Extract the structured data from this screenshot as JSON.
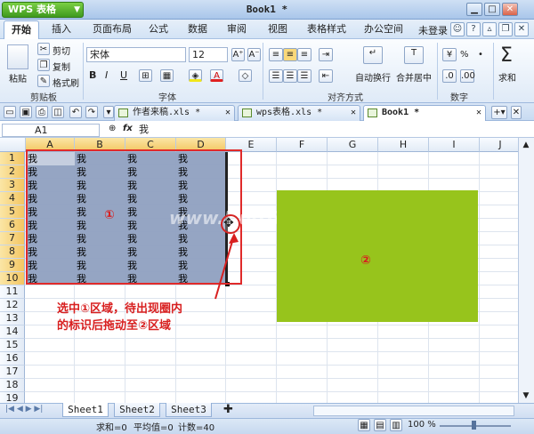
{
  "app": {
    "name": "WPS 表格",
    "doc_title": "Book1 *"
  },
  "menu": {
    "tabs": [
      "开始",
      "插入",
      "页面布局",
      "公式",
      "数据",
      "审阅",
      "视图",
      "表格样式",
      "办公空间"
    ],
    "login": "未登录"
  },
  "ribbon": {
    "clipboard": {
      "paste": "粘贴",
      "cut": "剪切",
      "copy": "复制",
      "format_painter": "格式刷",
      "label": "剪贴板"
    },
    "font": {
      "name": "宋体",
      "size": "12",
      "label": "字体",
      "bold": "B",
      "italic": "I",
      "underline": "U",
      "grow": "A⁺",
      "shrink": "A⁻"
    },
    "align": {
      "wrap": "自动换行",
      "merge": "合并居中",
      "label": "对齐方式"
    },
    "number": {
      "label": "数字",
      "percent": "%",
      "comma": "•"
    },
    "sum": {
      "label": "求和",
      "icon": "Σ"
    }
  },
  "doc_tabs": [
    {
      "name": "作者来稿.xls *"
    },
    {
      "name": "wps表格.xls *"
    },
    {
      "name": "Book1 *"
    }
  ],
  "formula_bar": {
    "cell_ref": "A1",
    "fx": "fx",
    "value": "我"
  },
  "grid": {
    "columns": [
      "A",
      "B",
      "C",
      "D",
      "E",
      "F",
      "G",
      "H",
      "I",
      "J"
    ],
    "rows": [
      "1",
      "2",
      "3",
      "4",
      "5",
      "6",
      "7",
      "8",
      "9",
      "10",
      "11",
      "12",
      "13",
      "14",
      "15",
      "16",
      "17",
      "18",
      "19"
    ],
    "cell_value": "我"
  },
  "annotations": {
    "region1": "①",
    "region2": "②",
    "instruction_line1": "选中①区域，待出现圈内",
    "instruction_line2": "的标识后拖动至②区域",
    "watermark": "www.DuoTe.com"
  },
  "sheets": [
    "Sheet1",
    "Sheet2",
    "Sheet3"
  ],
  "status": {
    "sum": "求和=0",
    "avg": "平均值=0",
    "count": "计数=40",
    "zoom": "100 %"
  },
  "colors": {
    "selection": "#8fa0c0",
    "target": "#97c41c",
    "annotation": "#e02a2a"
  }
}
